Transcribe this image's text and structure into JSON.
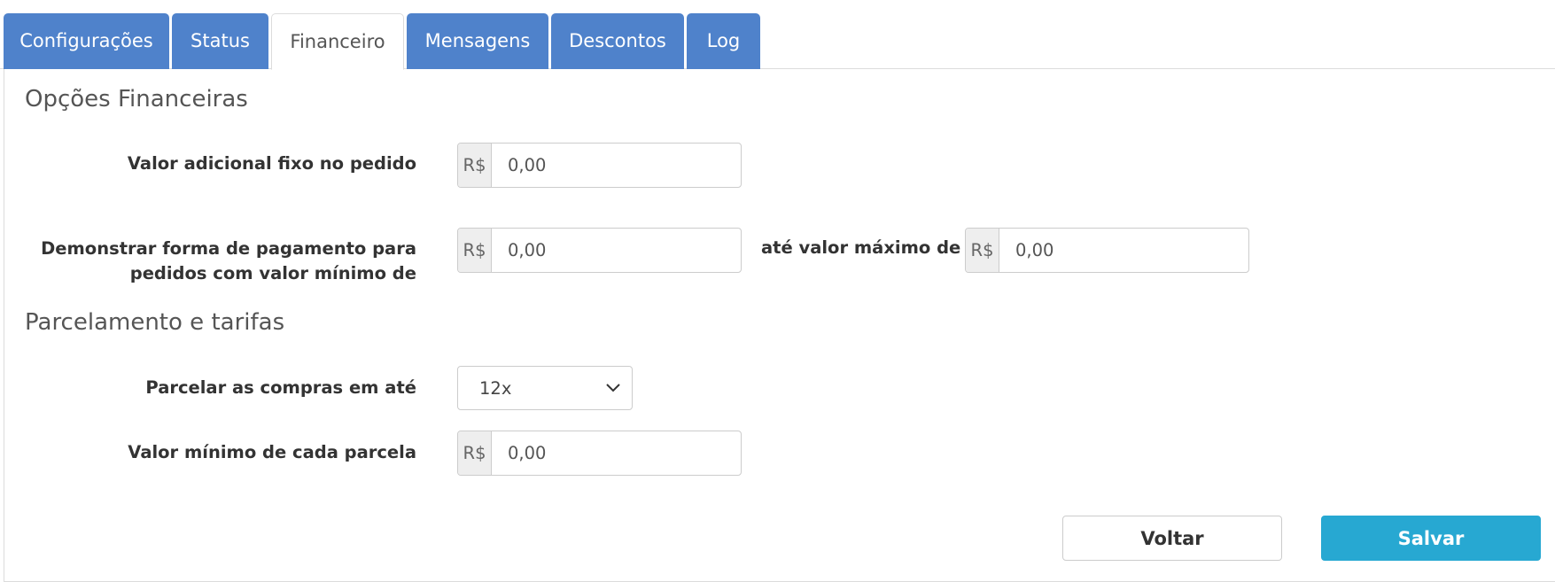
{
  "tabs": [
    {
      "label": "Configurações",
      "active": false
    },
    {
      "label": "Status",
      "active": false
    },
    {
      "label": "Financeiro",
      "active": true
    },
    {
      "label": "Mensagens",
      "active": false
    },
    {
      "label": "Descontos",
      "active": false
    },
    {
      "label": "Log",
      "active": false
    }
  ],
  "financial_options": {
    "title": "Opções Financeiras",
    "fixed_fee": {
      "label": "Valor adicional fixo no pedido",
      "currency": "R$",
      "value": "0,00"
    },
    "payment_range": {
      "label_line1": "Demonstrar forma de pagamento para",
      "label_line2": "pedidos com valor mínimo de",
      "min": {
        "currency": "R$",
        "value": "0,00"
      },
      "max_label": "até valor máximo de",
      "max": {
        "currency": "R$",
        "value": "0,00"
      }
    }
  },
  "installments": {
    "title": "Parcelamento e tarifas",
    "max_installments": {
      "label": "Parcelar as compras em até",
      "selected": "12x"
    },
    "min_installment": {
      "label": "Valor mínimo de cada parcela",
      "currency": "R$",
      "value": "0,00"
    }
  },
  "actions": {
    "back_label": "Voltar",
    "save_label": "Salvar"
  },
  "colors": {
    "tab_blue": "#4f82cb",
    "primary_button": "#27a8d2"
  },
  "icons": {
    "select_arrow": "chevron-down-icon"
  }
}
